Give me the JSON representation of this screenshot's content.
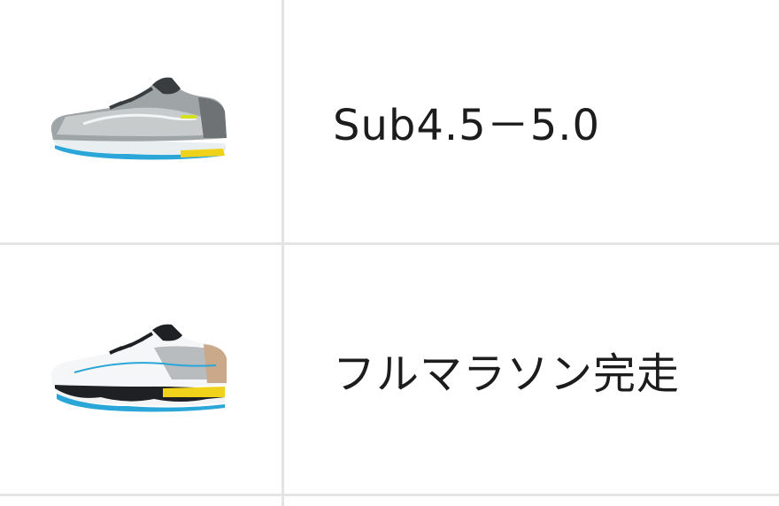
{
  "rows": [
    {
      "image": "gray-running-shoe",
      "label": "Sub4.5－5.0"
    },
    {
      "image": "white-running-shoe",
      "label": "フルマラソン完走"
    }
  ],
  "colors": {
    "grid_line": "#e4e4e4",
    "text": "#1c1c1c",
    "shoe_accent_blue": "#2aa6d8",
    "shoe_accent_yellow": "#f0d21a"
  }
}
